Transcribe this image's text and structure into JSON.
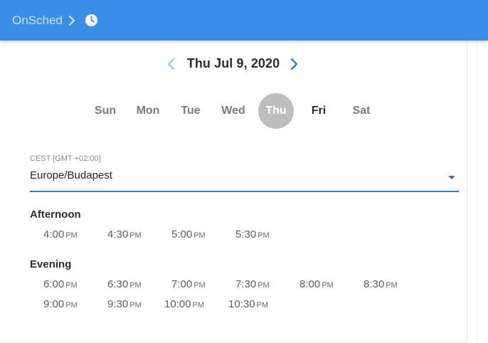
{
  "header": {
    "brand": "OnSched",
    "icons": [
      "chevron-right-icon",
      "clock-icon"
    ],
    "color": "#3a8ee6"
  },
  "date_nav": {
    "title": "Thu Jul 9, 2020",
    "prev_icon": "chevron-left-icon",
    "next_icon": "chevron-right-icon",
    "accent": "#2b7fd3"
  },
  "weekdays": [
    {
      "label": "Sun"
    },
    {
      "label": "Mon"
    },
    {
      "label": "Tue"
    },
    {
      "label": "Wed"
    },
    {
      "label": "Thu",
      "selected": true
    },
    {
      "label": "Fri"
    },
    {
      "label": "Sat"
    }
  ],
  "timezone": {
    "caption": "CEST [GMT +02:00]",
    "value": "Europe/Budapest"
  },
  "sections": [
    {
      "title": "Afternoon",
      "slots": [
        {
          "time": "4:00",
          "ampm": "PM"
        },
        {
          "time": "4:30",
          "ampm": "PM"
        },
        {
          "time": "5:00",
          "ampm": "PM"
        },
        {
          "time": "5:30",
          "ampm": "PM"
        }
      ]
    },
    {
      "title": "Evening",
      "slots": [
        {
          "time": "6:00",
          "ampm": "PM"
        },
        {
          "time": "6:30",
          "ampm": "PM"
        },
        {
          "time": "7:00",
          "ampm": "PM"
        },
        {
          "time": "7:30",
          "ampm": "PM"
        },
        {
          "time": "8:00",
          "ampm": "PM"
        },
        {
          "time": "8:30",
          "ampm": "PM"
        },
        {
          "time": "9:00",
          "ampm": "PM"
        },
        {
          "time": "9:30",
          "ampm": "PM"
        },
        {
          "time": "10:00",
          "ampm": "PM"
        },
        {
          "time": "10:30",
          "ampm": "PM"
        }
      ]
    }
  ]
}
